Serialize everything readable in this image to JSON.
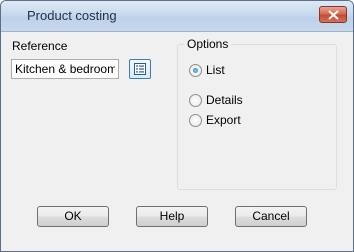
{
  "window": {
    "title": "Product costing"
  },
  "reference": {
    "label": "Reference",
    "value": "Kitchen & bedroom",
    "browse_icon": "list-icon"
  },
  "options": {
    "label": "Options",
    "items": [
      {
        "label": "List",
        "checked": true
      },
      {
        "label": "Details",
        "checked": false
      },
      {
        "label": "Export",
        "checked": false
      }
    ]
  },
  "buttons": {
    "ok": "OK",
    "help": "Help",
    "cancel": "Cancel"
  },
  "colors": {
    "close_button": "#c74a30",
    "accent": "#1a76b5"
  }
}
